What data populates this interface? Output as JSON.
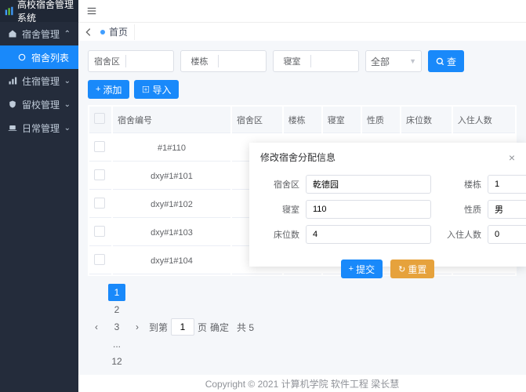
{
  "app": {
    "title": "高校宿舍管理系统"
  },
  "sidebar": {
    "items": [
      {
        "label": "宿舍管理",
        "icon": "home"
      },
      {
        "label": "宿舍列表",
        "icon": "circle"
      },
      {
        "label": "住宿管理",
        "icon": "chart"
      },
      {
        "label": "留校管理",
        "icon": "shield"
      },
      {
        "label": "日常管理",
        "icon": "laptop"
      }
    ]
  },
  "tabs": {
    "home": "首页"
  },
  "search": {
    "area_label": "宿舍区",
    "building_label": "楼栋",
    "room_label": "寝室",
    "select_all": "全部",
    "search_btn": "查"
  },
  "actions": {
    "add": "添加",
    "import": "导入"
  },
  "table": {
    "headers": [
      "宿舍编号",
      "宿舍区",
      "楼栋",
      "寝室",
      "性质",
      "床位数",
      "入住人数"
    ],
    "rows": [
      {
        "id": "#1#110"
      },
      {
        "id": "dxy#1#101"
      },
      {
        "id": "dxy#1#102"
      },
      {
        "id": "dxy#1#103"
      },
      {
        "id": "dxy#1#104"
      }
    ]
  },
  "pagination": {
    "pages": [
      "1",
      "2",
      "3",
      "...",
      "12"
    ],
    "jump": "到第",
    "page_suffix": "页",
    "confirm": "确定",
    "total_prefix": "共 5",
    "jump_value": "1"
  },
  "modal": {
    "title": "修改宿舍分配信息",
    "area_label": "宿舍区",
    "area_value": "乾德园",
    "building_label": "楼栋",
    "building_value": "1",
    "room_label": "寝室",
    "room_value": "110",
    "nature_label": "性质",
    "nature_value": "男",
    "beds_label": "床位数",
    "beds_value": "4",
    "occupants_label": "入住人数",
    "occupants_value": "0",
    "submit": "提交",
    "reset": "重置"
  },
  "footer": {
    "copyright": "Copyright © 2021 计算机学院 软件工程 梁长慧"
  }
}
